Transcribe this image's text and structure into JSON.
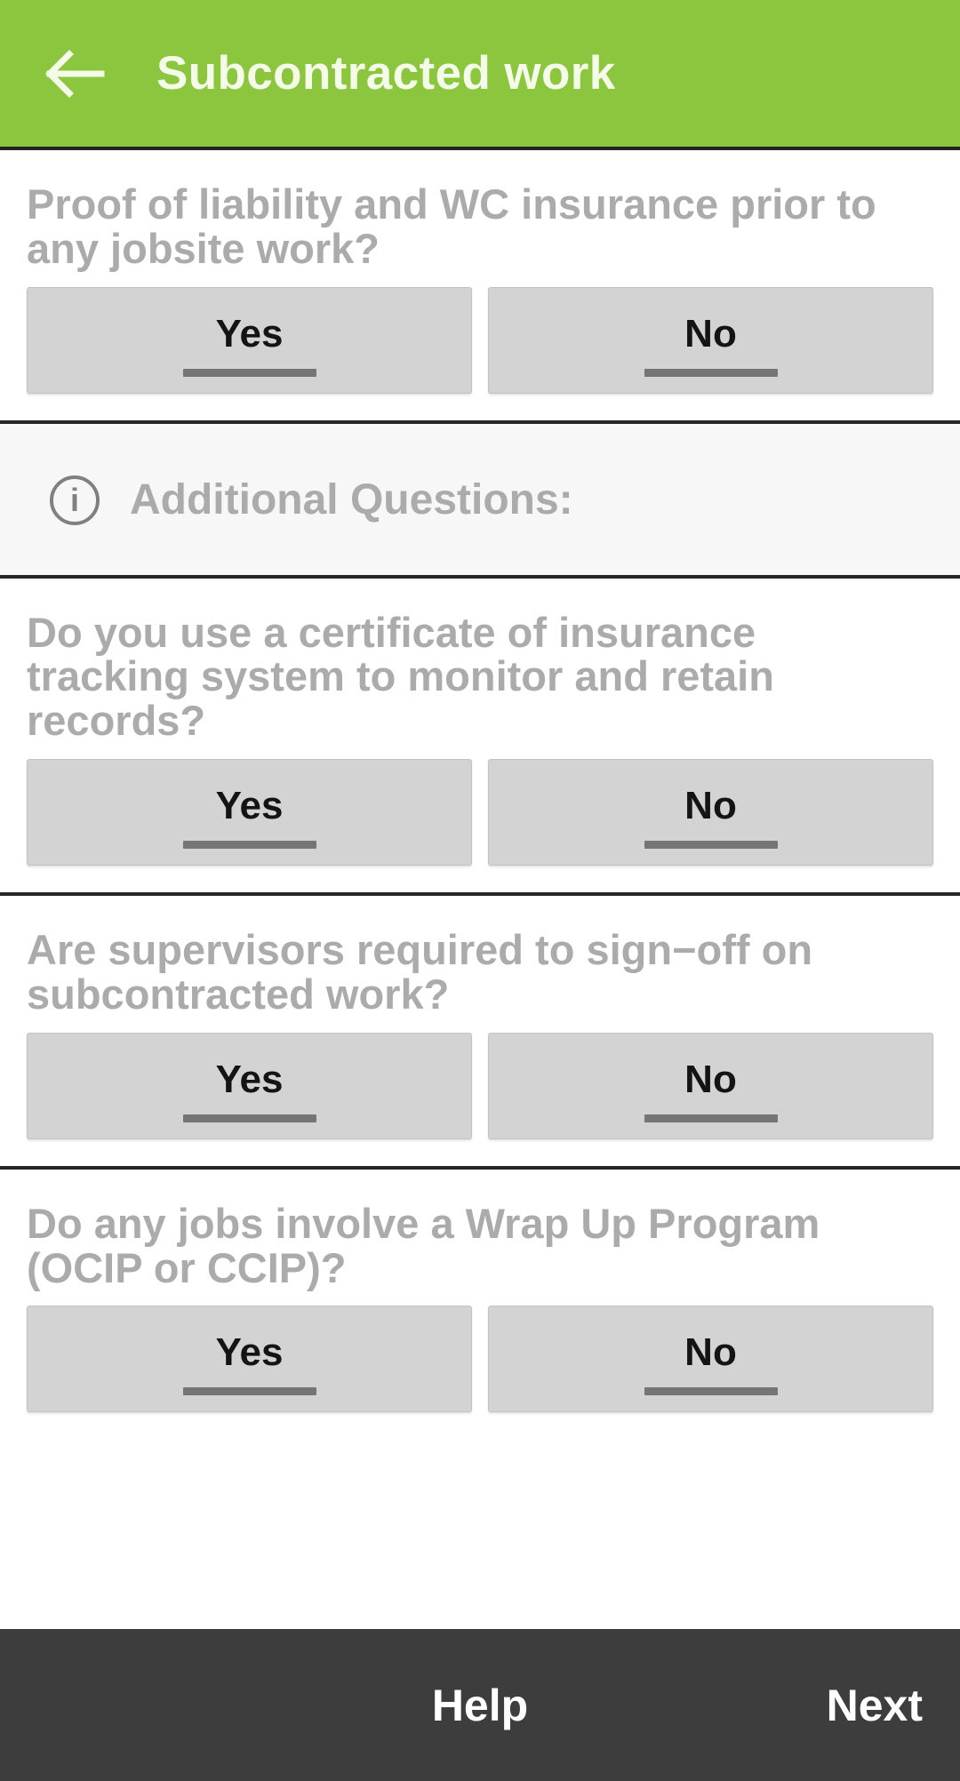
{
  "header": {
    "title": "Subcontracted work",
    "back_icon": "arrow-left-icon",
    "background_color": "#8CC63E",
    "title_color": "#F4FBE9"
  },
  "answer_options": {
    "yes": "Yes",
    "no": "No"
  },
  "section_banner": {
    "icon": "info-circle-icon",
    "icon_glyph": "i",
    "title": "Additional Questions:",
    "background_color": "#F7F7F7",
    "text_color": "#ABABAB"
  },
  "questions": [
    {
      "id": "proof-of-liability",
      "text": "Proof of liability and WC insurance prior to any jobsite work?",
      "yes": "Yes",
      "no": "No"
    },
    {
      "id": "coi-tracking-system",
      "text": "Do you use a certificate of insurance tracking system to monitor and retain records?",
      "yes": "Yes",
      "no": "No"
    },
    {
      "id": "supervisor-signoff",
      "text": "Are supervisors required to sign−off on subcontracted work?",
      "yes": "Yes",
      "no": "No"
    },
    {
      "id": "wrap-up-program",
      "text": "Do any jobs involve a Wrap Up Program (OCIP or CCIP)?",
      "yes": "Yes",
      "no": "No"
    }
  ],
  "bottom_bar": {
    "help_label": "Help",
    "next_label": "Next",
    "background_color": "#3D3D3D",
    "text_color": "#FFFFFF"
  },
  "colors": {
    "accent_green": "#8CC63E",
    "question_text": "#ABABAB",
    "button_face": "#D3D3D3",
    "button_underline": "#757575",
    "divider": "#262626",
    "bottom_bar": "#3D3D3D"
  }
}
